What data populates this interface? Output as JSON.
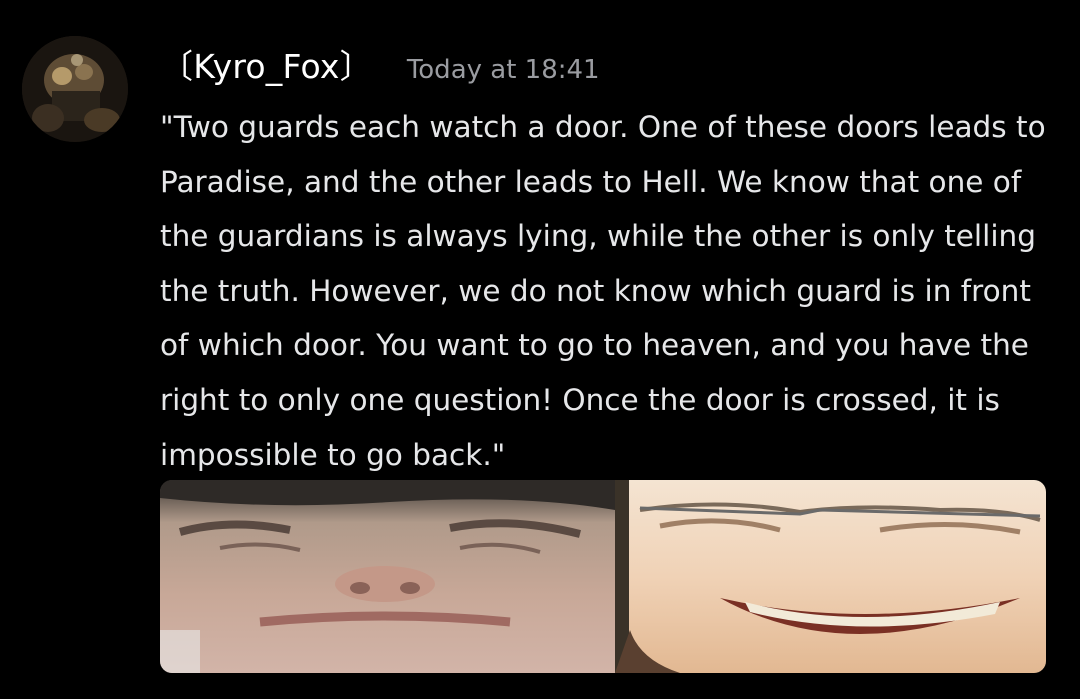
{
  "message": {
    "username": "〔Kyro_Fox〕",
    "timestamp": "Today at 18:41",
    "text": "\"Two guards each watch a door. One of these doors leads to Paradise, and the other leads to Hell. We know that one of the guardians is always lying, while the other is only telling the truth. However, we do not know which guard is in front of which door. You want to go to heaven, and you have the right to only one question! Once the door is crossed, it is impossible to go back.\""
  },
  "colors": {
    "background": "#000000",
    "username": "#ffffff",
    "timestamp": "#9a9ca1",
    "text": "#e6e7e9"
  },
  "icons": {
    "avatar": "user-avatar-image",
    "attachment": "attached-image-two-faces"
  }
}
